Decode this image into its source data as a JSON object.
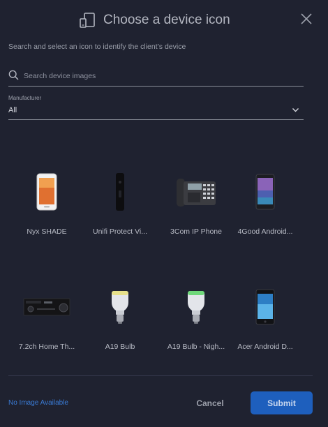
{
  "dialog": {
    "title": "Choose a device icon",
    "subtitle": "Search and select an icon to identify the client’s device"
  },
  "search": {
    "placeholder": "Search device images",
    "value": ""
  },
  "manufacturer": {
    "label": "Manufacturer",
    "value": "All"
  },
  "devices": [
    {
      "label": "Nyx SHADE",
      "icon": "phone-white-icon"
    },
    {
      "label": "Unifi Protect Vi...",
      "icon": "doorbell-camera-icon"
    },
    {
      "label": "3Com IP Phone",
      "icon": "desk-phone-icon"
    },
    {
      "label": "4Good Android...",
      "icon": "android-phone-icon"
    },
    {
      "label": "7.2ch Home Th...",
      "icon": "av-receiver-icon"
    },
    {
      "label": "A19 Bulb",
      "icon": "bulb-yellow-icon"
    },
    {
      "label": "A19 Bulb - Nigh...",
      "icon": "bulb-green-icon"
    },
    {
      "label": "Acer Android D...",
      "icon": "acer-phone-icon"
    }
  ],
  "footer": {
    "no_image_label": "No Image Available",
    "cancel_label": "Cancel",
    "submit_label": "Submit"
  },
  "colors": {
    "background": "#1f2230",
    "accent": "#1e5fbd",
    "link": "#3a7bd5"
  }
}
